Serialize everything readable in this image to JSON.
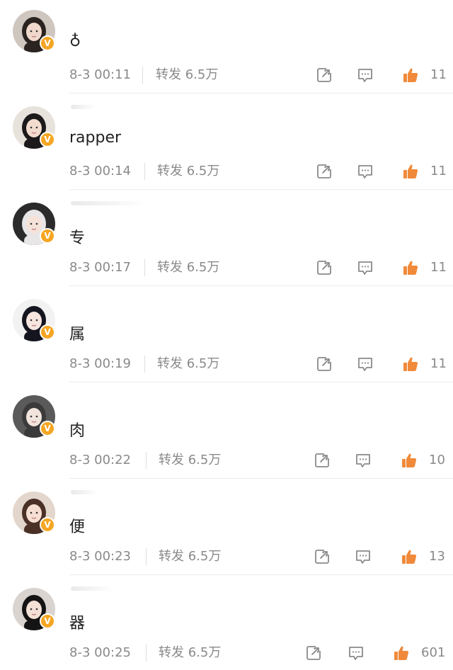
{
  "colors": {
    "accent": "#f5a623",
    "like": "#f08a3a",
    "meta_text": "#8a8a8a",
    "divider": "#ececec"
  },
  "comments": [
    {
      "text": "♁",
      "time": "8-3 00:11",
      "repost": "转发 6.5万",
      "likes": "11",
      "avatar": {
        "bg": "#cfc6c0",
        "hair": "#2a2320",
        "skin": "#f0d9cc"
      },
      "verified": "V"
    },
    {
      "text": "rapper",
      "time": "8-3 00:14",
      "repost": "转发 6.5万",
      "likes": "11",
      "avatar": {
        "bg": "#e8e2dc",
        "hair": "#1c1a1a",
        "skin": "#f2dccf"
      },
      "verified": "V"
    },
    {
      "text": "专",
      "time": "8-3 00:17",
      "repost": "转发 6.5万",
      "likes": "11",
      "avatar": {
        "bg": "#2b2b2b",
        "hair": "#e8e6e6",
        "skin": "#f5e3da"
      },
      "verified": "V"
    },
    {
      "text": "属",
      "time": "8-3 00:19",
      "repost": "转发 6.5万",
      "likes": "11",
      "avatar": {
        "bg": "#f2f2f2",
        "hair": "#151520",
        "skin": "#f7e6e0"
      },
      "verified": "V"
    },
    {
      "text": "肉",
      "time": "8-3 00:22",
      "repost": "转发 6.5万",
      "likes": "10",
      "avatar": {
        "bg": "#5a5a5a",
        "hair": "#3a3a3a",
        "skin": "#f0e4dc"
      },
      "verified": "V"
    },
    {
      "text": "便",
      "time": "8-3 00:23",
      "repost": "转发 6.5万",
      "likes": "13",
      "avatar": {
        "bg": "#e3d6cc",
        "hair": "#4a3026",
        "skin": "#f6dfd2"
      },
      "verified": "V"
    },
    {
      "text": "器",
      "time": "8-3 00:25",
      "repost": "转发 6.5万",
      "likes": "601",
      "avatar": {
        "bg": "#d9d4d0",
        "hair": "#141414",
        "skin": "#f3e0d6"
      },
      "verified": "V"
    }
  ],
  "icons": {
    "share": "share-box-icon",
    "comment": "comment-bubble-icon",
    "like": "thumbs-up-icon"
  }
}
